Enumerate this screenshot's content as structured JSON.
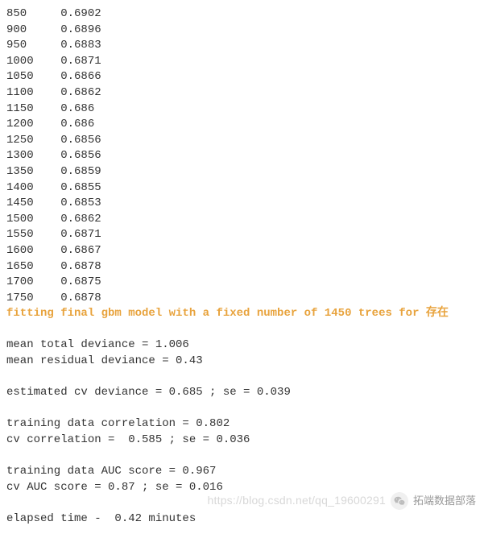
{
  "iterations": [
    {
      "n": "850",
      "v": "0.6902"
    },
    {
      "n": "900",
      "v": "0.6896"
    },
    {
      "n": "950",
      "v": "0.6883"
    },
    {
      "n": "1000",
      "v": "0.6871"
    },
    {
      "n": "1050",
      "v": "0.6866"
    },
    {
      "n": "1100",
      "v": "0.6862"
    },
    {
      "n": "1150",
      "v": "0.686"
    },
    {
      "n": "1200",
      "v": "0.686"
    },
    {
      "n": "1250",
      "v": "0.6856"
    },
    {
      "n": "1300",
      "v": "0.6856"
    },
    {
      "n": "1350",
      "v": "0.6859"
    },
    {
      "n": "1400",
      "v": "0.6855"
    },
    {
      "n": "1450",
      "v": "0.6853"
    },
    {
      "n": "1500",
      "v": "0.6862"
    },
    {
      "n": "1550",
      "v": "0.6871"
    },
    {
      "n": "1600",
      "v": "0.6867"
    },
    {
      "n": "1650",
      "v": "0.6878"
    },
    {
      "n": "1700",
      "v": "0.6875"
    },
    {
      "n": "1750",
      "v": "0.6878"
    }
  ],
  "fitting_line": "fitting final gbm model with a fixed number of 1450 trees for 存在",
  "stats": {
    "mean_total_deviance": "mean total deviance = 1.006",
    "mean_residual_deviance": "mean residual deviance = 0.43",
    "estimated_cv_deviance": "estimated cv deviance = 0.685 ; se = 0.039",
    "training_corr": "training data correlation = 0.802",
    "cv_corr": "cv correlation =  0.585 ; se = 0.036",
    "training_auc": "training data AUC score = 0.967",
    "cv_auc": "cv AUC score = 0.87 ; se = 0.016",
    "elapsed": "elapsed time -  0.42 minutes"
  },
  "watermark": {
    "url": "https://blog.csdn.net/qq_19600291",
    "label": "拓端数据部落"
  }
}
